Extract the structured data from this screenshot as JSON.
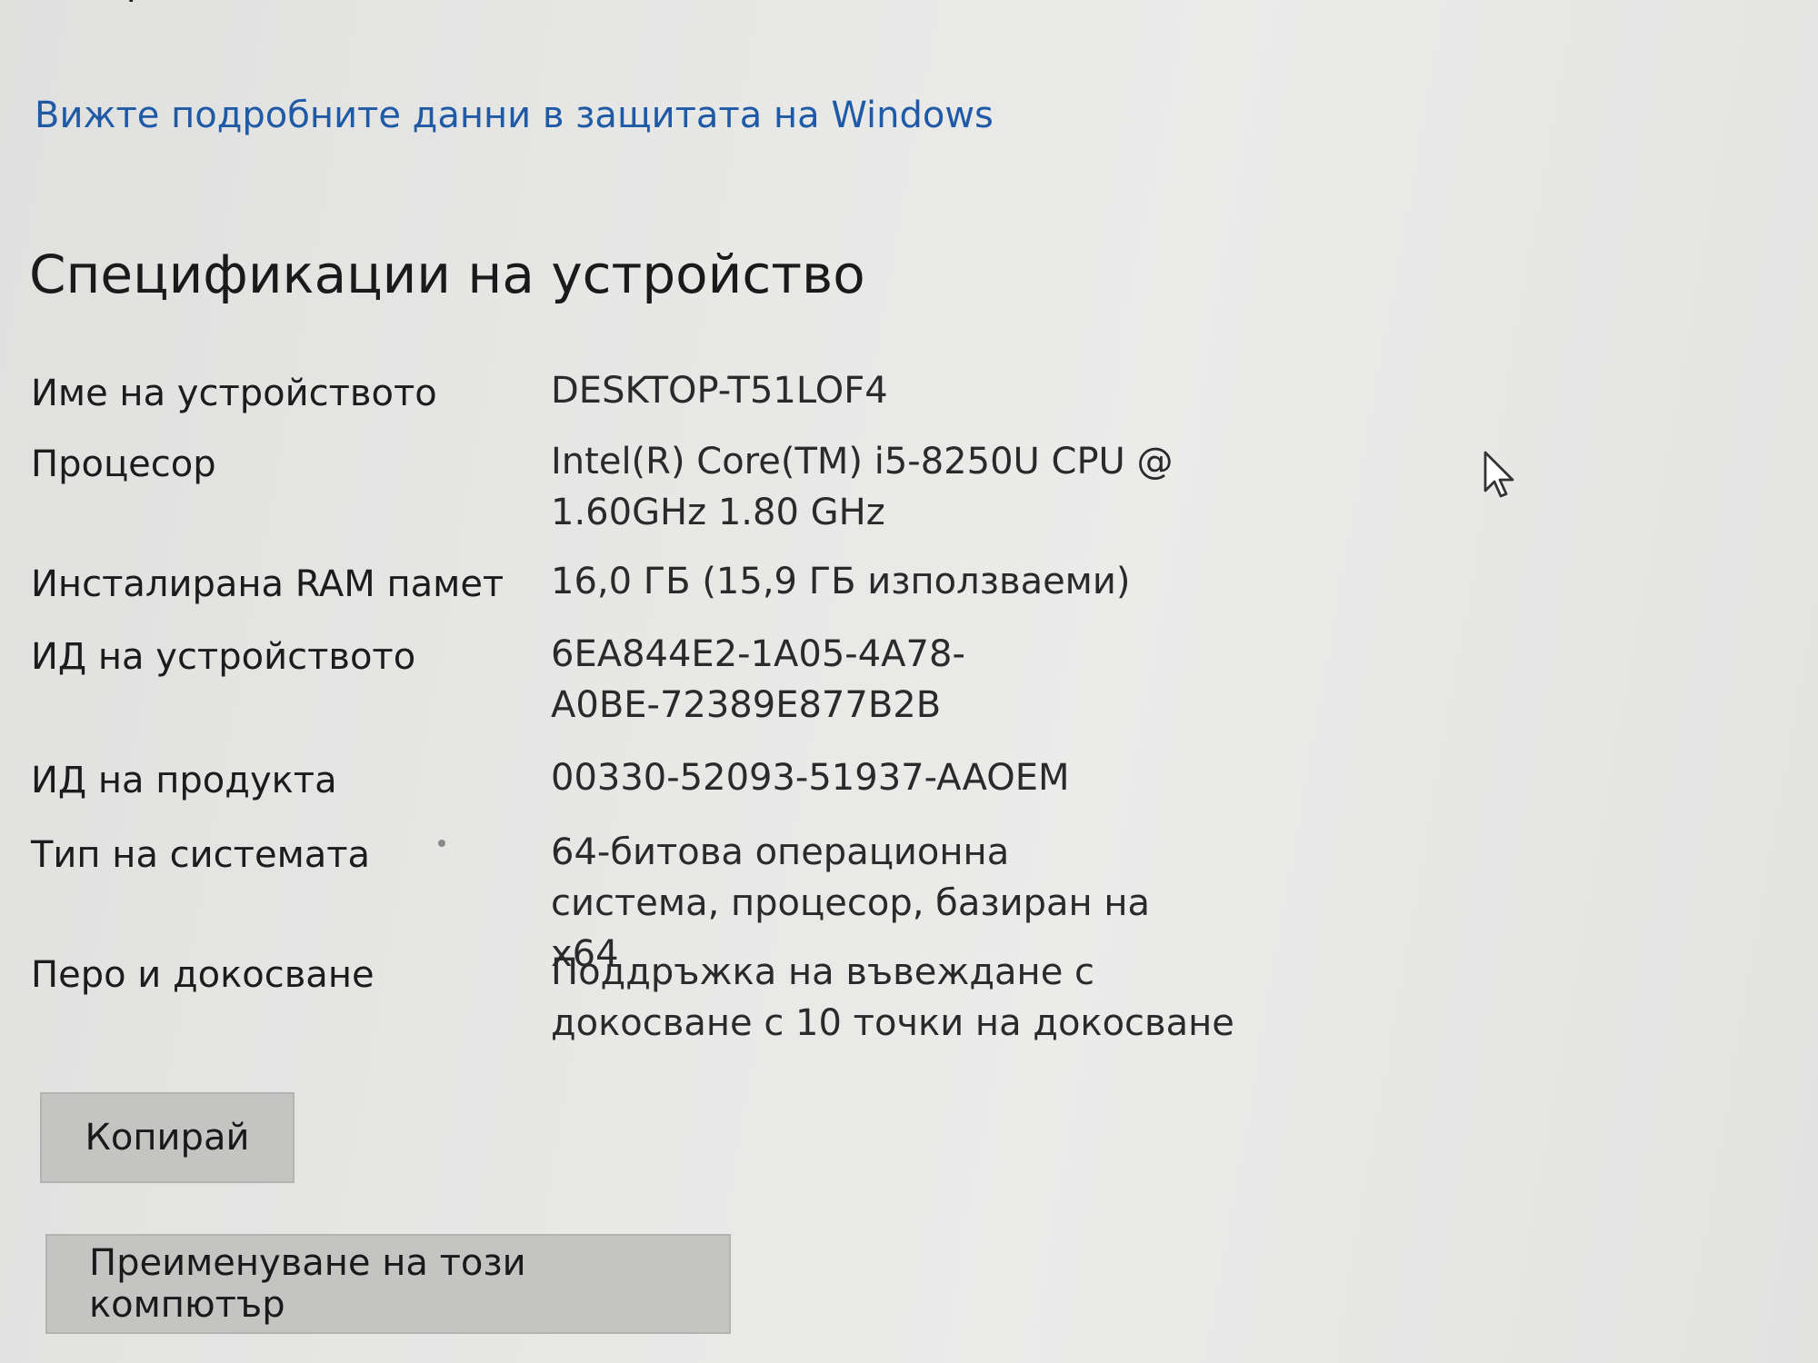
{
  "header": {
    "partial_text": "защитен.",
    "security_link": "Вижте подробните данни в защитата на Windows"
  },
  "specs": {
    "title": "Спецификации на устройство",
    "rows": [
      {
        "label": "Име на устройството",
        "value": "DESKTOP-T51LOF4"
      },
      {
        "label": "Процесор",
        "value": "Intel(R) Core(TM) i5-8250U CPU @ 1.60GHz   1.80 GHz"
      },
      {
        "label": "Инсталирана RAM памет",
        "value": "16,0 ГБ (15,9 ГБ използваеми)"
      },
      {
        "label": "ИД на устройството",
        "value": "6EA844E2-1A05-4A78-A0BE-72389E877B2B"
      },
      {
        "label": "ИД на продукта",
        "value": "00330-52093-51937-AAOEM"
      },
      {
        "label": "Тип на системата",
        "value": "64-битова операционна система, процесор, базиран на x64"
      },
      {
        "label": "Перо и докосване",
        "value": "Поддръжка на въвеждане с докосване с 10 точки на докосване"
      }
    ]
  },
  "buttons": {
    "copy": "Копирай",
    "rename": "Преименуване на този компютър"
  },
  "icons": {
    "cursor": "mouse-pointer-icon"
  }
}
